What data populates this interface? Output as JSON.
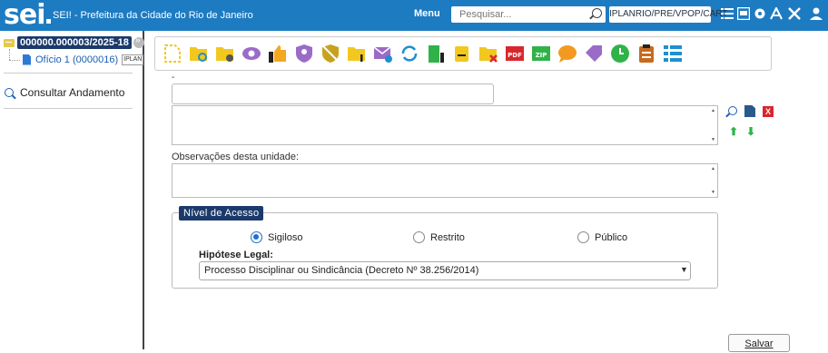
{
  "header": {
    "logo_text": "sei",
    "app_title": "SEI! - Prefeitura da Cidade do Rio de Janeiro",
    "menu_label": "Menu",
    "search_placeholder": "Pesquisar...",
    "unit": "IPLANRIO/PRE/VPOP/CART",
    "icons": [
      "menu-lines-icon",
      "calculator-icon",
      "gear-icon",
      "font-size-icon",
      "tools-icon",
      "user-icon"
    ]
  },
  "tree": {
    "process_number": "000000.000003/2025-18",
    "document_label": "Ofício 1 (0000016)",
    "document_unit": "IPLAN"
  },
  "sidebar": {
    "consult_label": "Consultar Andamento"
  },
  "toolbar": {
    "icons": [
      "new-document-icon",
      "folder-refresh-icon",
      "folder-settings-icon",
      "eye-icon",
      "thumbs-up-icon",
      "shield-user-icon",
      "shield-slash-icon",
      "folder-info-icon",
      "email-icon",
      "sync-icon",
      "building-icon",
      "list-user-icon",
      "folder-remove-icon",
      "pdf-icon",
      "zip-icon",
      "comment-icon",
      "tag-icon",
      "clock-icon",
      "clipboard-icon",
      "list-icon"
    ],
    "pdf_text": "PDF",
    "zip_text": "ZIP"
  },
  "form": {
    "top_label": "-",
    "observacoes_label": "Observações desta unidade:",
    "side_remove": "X"
  },
  "access": {
    "legend": "Nível de Acesso",
    "options": [
      "Sigiloso",
      "Restrito",
      "Público"
    ],
    "selected": "Sigiloso",
    "hipotese_label": "Hipótese Legal:",
    "hipotese_value": "Processo Disciplinar ou Sindicância (Decreto Nº 38.256/2014)"
  },
  "actions": {
    "save_label": "Salvar"
  },
  "colors": {
    "header_bg": "#1d7bc2",
    "accent_dark": "#1b3a6b",
    "toolbar_yellow": "#f2c81f",
    "toolbar_purple": "#9b6bc8",
    "toolbar_green": "#2fb349",
    "toolbar_red": "#d9262c"
  }
}
